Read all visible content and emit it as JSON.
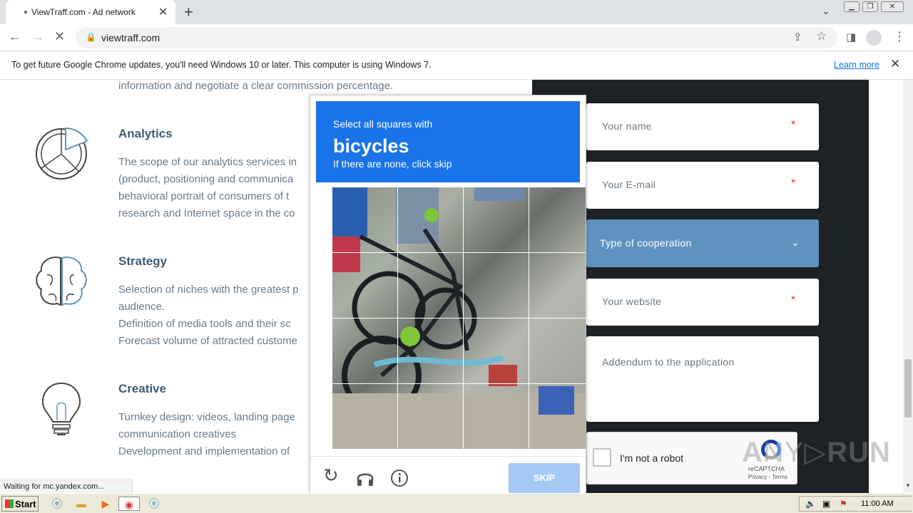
{
  "browser": {
    "tab_title": "ViewTraff.com - Ad network",
    "url": "viewtraff.com",
    "status_text": "Waiting for mc.yandex.com...",
    "infobar_message": "To get future Google Chrome updates, you'll need Windows 10 or later. This computer is using Windows 7.",
    "infobar_link": "Learn more"
  },
  "page": {
    "intro_line": "information and negotiate a clear commission percentage.",
    "sections": [
      {
        "title": "Analytics",
        "lines": [
          "The scope of our analytics services in",
          "(product, positioning and communica",
          "behavioral portrait of consumers of t",
          "research and Internet space in the co"
        ]
      },
      {
        "title": "Strategy",
        "lines": [
          "Selection of niches with the greatest p",
          "audience.",
          "Definition of media tools and their sc",
          "Forecast volume of attracted custome"
        ]
      },
      {
        "title": "Creative",
        "lines": [
          "Turnkey design: videos, landing page",
          "communication creatives",
          "Development and implementation of"
        ]
      }
    ],
    "form": {
      "name_placeholder": "Your name",
      "email_placeholder": "Your E-mail",
      "cooperation_label": "Type of cooperation",
      "website_placeholder": "Your website",
      "addendum_placeholder": "Addendum to the application",
      "required_mark": "*",
      "recaptcha_label": "I'm not a robot",
      "recaptcha_brand": "reCAPTCHA",
      "recaptcha_terms": "Privacy - Terms"
    }
  },
  "captcha": {
    "instruction": "Select all squares with",
    "target": "bicycles",
    "hint": "If there are none, click skip",
    "skip_label": "SKIP"
  },
  "watermark": "ANY.RUN",
  "taskbar": {
    "start_label": "Start",
    "clock": "11:00 AM"
  },
  "colors": {
    "captcha_header": "#1a73e8",
    "cooperation_select": "#5e93c0",
    "dark_panel": "#1e2227",
    "heading": "#3e5c73"
  }
}
